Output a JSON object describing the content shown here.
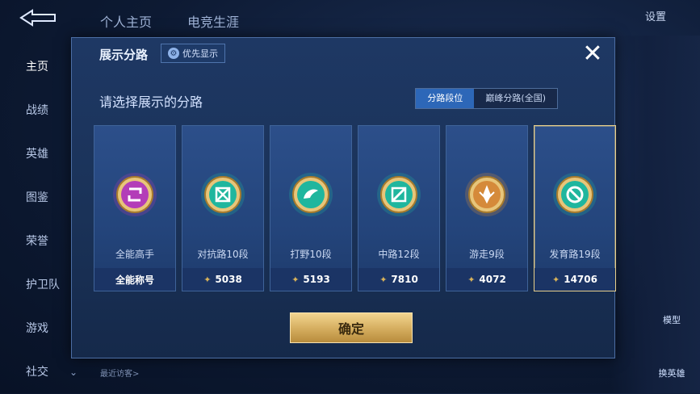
{
  "background": {
    "top_tabs": [
      "个人主页",
      "电竞生涯"
    ],
    "settings": "设置",
    "left_nav": [
      {
        "label": "主页",
        "chevron": false,
        "active": true
      },
      {
        "label": "战绩",
        "chevron": false,
        "active": false
      },
      {
        "label": "英雄",
        "chevron": false,
        "active": false
      },
      {
        "label": "图鉴",
        "chevron": true,
        "active": false
      },
      {
        "label": "荣誉",
        "chevron": true,
        "active": false
      },
      {
        "label": "护卫队",
        "chevron": true,
        "active": false
      },
      {
        "label": "游戏",
        "chevron": true,
        "active": false
      },
      {
        "label": "社交",
        "chevron": true,
        "active": false
      }
    ],
    "recent_visitors": "最近访客>",
    "right_buttons": [
      "模型",
      "换英雄"
    ]
  },
  "dialog": {
    "title": "展示分路",
    "priority_button": "优先显示",
    "prompt": "请选择展示的分路",
    "tabs": [
      {
        "label": "分路段位",
        "active": true
      },
      {
        "label": "巅峰分路(全国)",
        "active": false
      }
    ],
    "cards": [
      {
        "label": "全能高手",
        "value": "全能称号",
        "has_rank_icon": false,
        "emblem": "all-round-emblem",
        "color": "#b33db8",
        "selected": false
      },
      {
        "label": "对抗路10段",
        "value": "5038",
        "has_rank_icon": true,
        "emblem": "clash-lane-emblem",
        "color": "#1fb69e",
        "selected": false
      },
      {
        "label": "打野10段",
        "value": "5193",
        "has_rank_icon": true,
        "emblem": "jungle-dragon-emblem",
        "color": "#1fb69e",
        "selected": false
      },
      {
        "label": "中路12段",
        "value": "7810",
        "has_rank_icon": true,
        "emblem": "mid-lane-emblem",
        "color": "#1fb69e",
        "selected": false
      },
      {
        "label": "游走9段",
        "value": "4072",
        "has_rank_icon": true,
        "emblem": "roam-wings-emblem",
        "color": "#d58a3a",
        "selected": false
      },
      {
        "label": "发育路19段",
        "value": "14706",
        "has_rank_icon": true,
        "emblem": "farm-lane-emblem",
        "color": "#1fb69e",
        "selected": true
      }
    ],
    "confirm": "确定"
  }
}
